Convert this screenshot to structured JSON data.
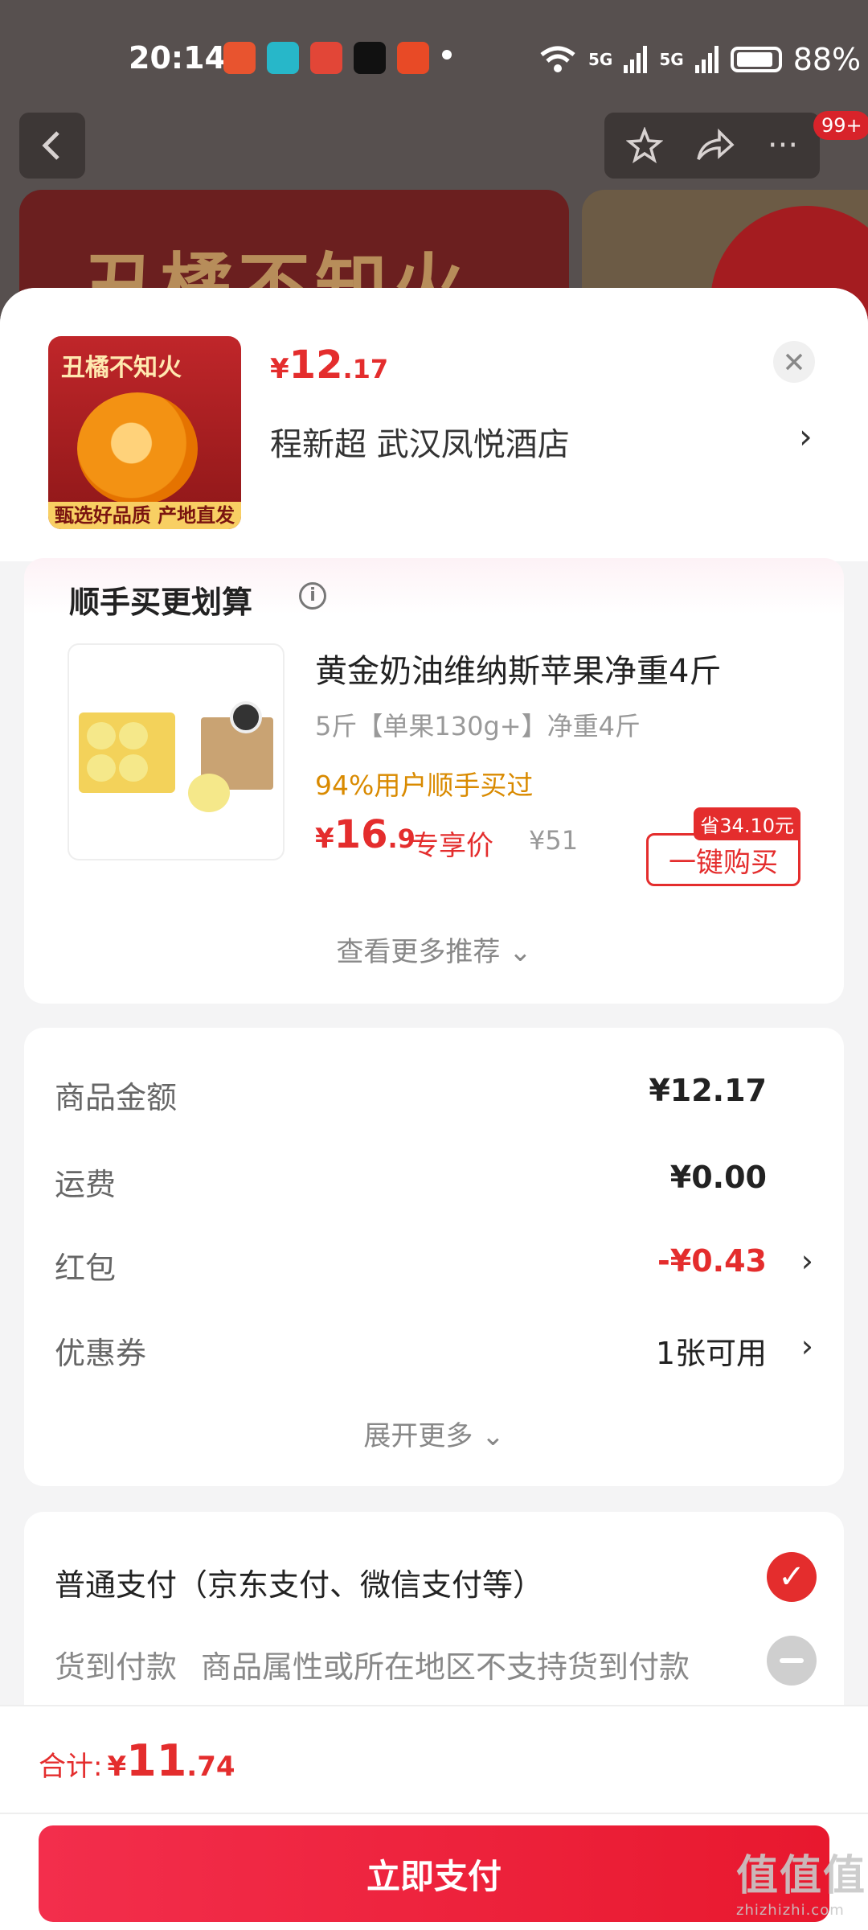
{
  "status_bar": {
    "time": "20:14",
    "network1": "5G",
    "network2": "5G",
    "battery": "88%"
  },
  "backdrop": {
    "banner_text": "丑橘不知火",
    "badge": "99+"
  },
  "order_head": {
    "thumb_title": "丑橘不知火",
    "thumb_caption": "甄选好品质 产地直发",
    "price_symbol": "¥",
    "price_int": "12",
    "price_dec": ".17",
    "address": "程新超  武汉凤悦酒店"
  },
  "recommend": {
    "title": "顺手买更划算",
    "item_name": "黄金奶油维纳斯苹果净重4斤",
    "item_spec": "5斤【单果130g+】净重4斤",
    "users_text": "94%用户顺手买过",
    "price_symbol": "¥",
    "price_int": "16",
    "price_dec": ".9",
    "exclusive_label": "专享价",
    "original_price": "¥51",
    "save_tag": "省34.10元",
    "buy_button": "一键购买",
    "more_link": "查看更多推荐 ⌄"
  },
  "summary": {
    "rows": [
      {
        "label": "商品金额",
        "value": "¥12.17"
      },
      {
        "label": "运费",
        "value": "¥0.00"
      },
      {
        "label": "红包",
        "value": "-¥0.43"
      },
      {
        "label": "优惠券",
        "value": "1张可用"
      }
    ],
    "expand_link": "展开更多 ⌄"
  },
  "payment": {
    "option1": "普通支付（京东支付、微信支付等）",
    "option2_label": "货到付款",
    "option2_note": "商品属性或所在地区不支持货到付款"
  },
  "footer": {
    "total_label": "合计:",
    "total_symbol": "¥",
    "total_int": "11",
    "total_dec": ".74",
    "pay_button": "立即支付"
  },
  "watermark": {
    "main": "值值值",
    "sub": "zhizhizhi.com"
  },
  "colors": {
    "accent_red": "#e42d2d",
    "warning_orange": "#d98a00"
  }
}
